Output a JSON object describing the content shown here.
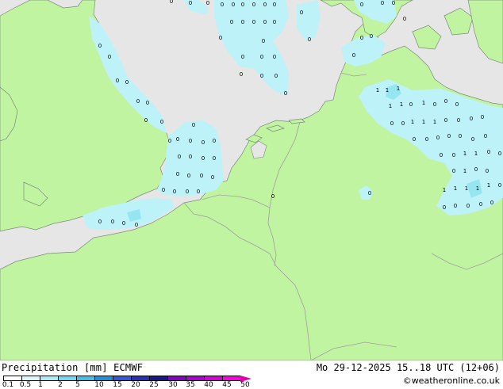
{
  "header": {
    "product": "Precipitation [mm] ECMWF",
    "valid_time": "Mo 29-12-2025 15..18 UTC (12+06)",
    "credit": "©weatheronline.co.uk"
  },
  "legend": {
    "labels": [
      "0.1",
      "0.5",
      "1",
      "2",
      "5",
      "10",
      "15",
      "20",
      "25",
      "30",
      "35",
      "40",
      "45",
      "50"
    ],
    "colors": [
      "#ffffff",
      "#d8f6ff",
      "#a8ecfc",
      "#70d8f4",
      "#40bfe8",
      "#1f8fe0",
      "#3058d8",
      "#2830b8",
      "#18188c",
      "#8800c8",
      "#b000d8",
      "#d800d8",
      "#ff00e0",
      "#e000a8"
    ]
  },
  "map": {
    "colors": {
      "sea": "#e6e6e6",
      "land": "#c0f4a0",
      "precip": "#bdf2f8",
      "precip_core": "#96e6f2",
      "border": "#a0a0a0",
      "coast": "#7c8c7c"
    },
    "precip_amount_labels": [
      "0",
      "1"
    ]
  }
}
